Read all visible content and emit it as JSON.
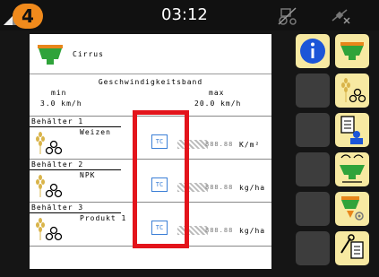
{
  "topbar": {
    "screen_number": "4",
    "time": "03:12"
  },
  "header": {
    "machine": "Cirrus"
  },
  "speed": {
    "title": "Geschwindigkeitsband",
    "min_label": "min",
    "max_label": "max",
    "min_value": "3.0  km/h",
    "max_value": "20.0  km/h"
  },
  "bins": [
    {
      "title": "Behälter 1",
      "product": "Weizen",
      "tc": "TC",
      "value": "888.88",
      "unit": "K/m²"
    },
    {
      "title": "Behälter 2",
      "product": "NPK",
      "tc": "TC",
      "value": "888.88",
      "unit": "kg/ha"
    },
    {
      "title": "Behälter 3",
      "product": "Produkt 1",
      "tc": "TC",
      "value": "888.88",
      "unit": "kg/ha"
    }
  ],
  "colors": {
    "accent": "#f08a1c",
    "highlight": "#e3141b",
    "hopper_green": "#2fa33a",
    "hopper_orange": "#e8861a",
    "info_blue": "#1c55d8",
    "tc_blue": "#3b7fd6"
  }
}
